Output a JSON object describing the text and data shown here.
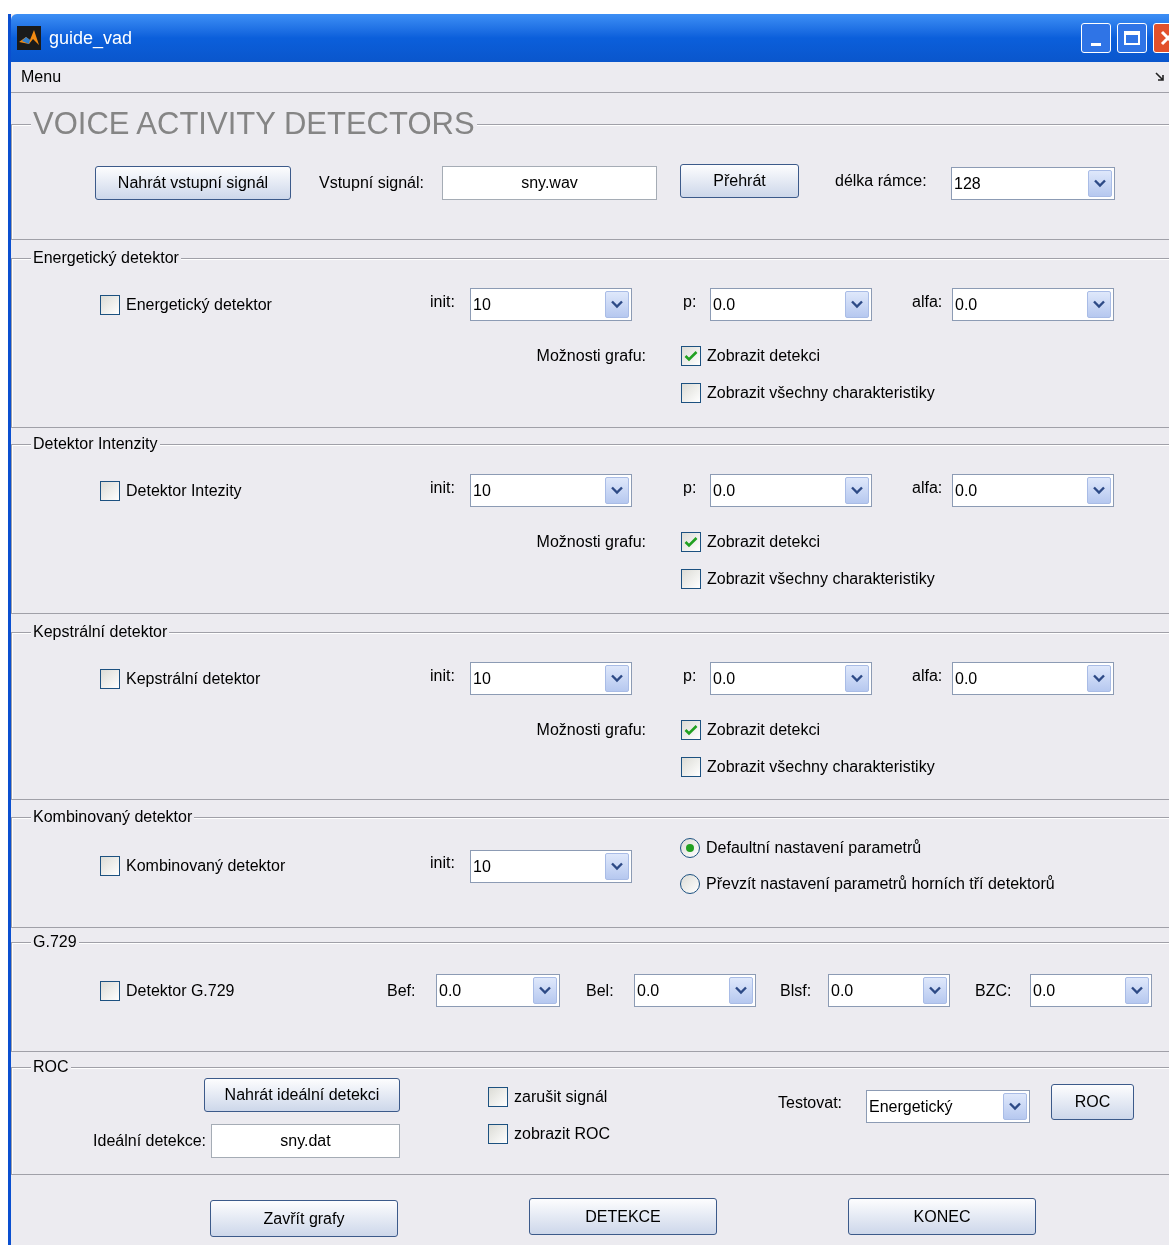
{
  "window": {
    "title": "guide_vad"
  },
  "menu": [
    {
      "label": "Menu"
    }
  ],
  "header": {
    "title": "VOICE ACTIVITY DETECTORS",
    "load_button": "Nahrát vstupní signál",
    "signal_label": "Vstupní signál:",
    "signal_value": "sny.wav",
    "play_button": "Přehrát",
    "frame_label": "délka rámce:",
    "frame_value": "128"
  },
  "detectors": [
    {
      "legend": "Energetický detektor",
      "enabled": {
        "label": "Energetický detektor",
        "checked": false
      },
      "params": [
        {
          "label": "init:",
          "value": "10"
        },
        {
          "label": "p:",
          "value": "0.0"
        },
        {
          "label": "alfa:",
          "value": "0.0"
        }
      ],
      "graph_label": "Možnosti grafu:",
      "graph_options": [
        {
          "label": "Zobrazit detekci",
          "checked": true
        },
        {
          "label": "Zobrazit všechny charakteristiky",
          "checked": false
        }
      ]
    },
    {
      "legend": "Detektor Intenzity",
      "enabled": {
        "label": "Detektor Intezity",
        "checked": false
      },
      "params": [
        {
          "label": "init:",
          "value": "10"
        },
        {
          "label": "p:",
          "value": "0.0"
        },
        {
          "label": "alfa:",
          "value": "0.0"
        }
      ],
      "graph_label": "Možnosti grafu:",
      "graph_options": [
        {
          "label": "Zobrazit detekci",
          "checked": true
        },
        {
          "label": "Zobrazit všechny charakteristiky",
          "checked": false
        }
      ]
    },
    {
      "legend": "Kepstrální detektor",
      "enabled": {
        "label": "Kepstrální detektor",
        "checked": false
      },
      "params": [
        {
          "label": "init:",
          "value": "10"
        },
        {
          "label": "p:",
          "value": "0.0"
        },
        {
          "label": "alfa:",
          "value": "0.0"
        }
      ],
      "graph_label": "Možnosti grafu:",
      "graph_options": [
        {
          "label": "Zobrazit detekci",
          "checked": true
        },
        {
          "label": "Zobrazit všechny charakteristiky",
          "checked": false
        }
      ]
    }
  ],
  "combined": {
    "legend": "Kombinovaný detektor",
    "enabled": {
      "label": "Kombinovaný detektor",
      "checked": false
    },
    "init": {
      "label": "init:",
      "value": "10"
    },
    "modes": [
      {
        "label": "Defaultní nastavení parametrů",
        "selected": true
      },
      {
        "label": "Převzít nastavení parametrů horních tří detektorů",
        "selected": false
      }
    ]
  },
  "g729": {
    "legend": "G.729",
    "enabled": {
      "label": "Detektor G.729",
      "checked": false
    },
    "params": [
      {
        "label": "Bef:",
        "value": "0.0"
      },
      {
        "label": "Bel:",
        "value": "0.0"
      },
      {
        "label": "Blsf:",
        "value": "0.0"
      },
      {
        "label": "BZC:",
        "value": "0.0"
      }
    ]
  },
  "roc": {
    "legend": "ROC",
    "load_button": "Nahrát ideální detekci",
    "ideal_label": "Ideální detekce:",
    "ideal_value": "sny.dat",
    "options": [
      {
        "label": "zarušit signál",
        "checked": false
      },
      {
        "label": "zobrazit ROC",
        "checked": false
      }
    ],
    "test_label": "Testovat:",
    "test_value": "Energetický",
    "roc_button": "ROC"
  },
  "buttons": [
    "Zavřít grafy",
    "DETEKCE",
    "KONEC"
  ]
}
